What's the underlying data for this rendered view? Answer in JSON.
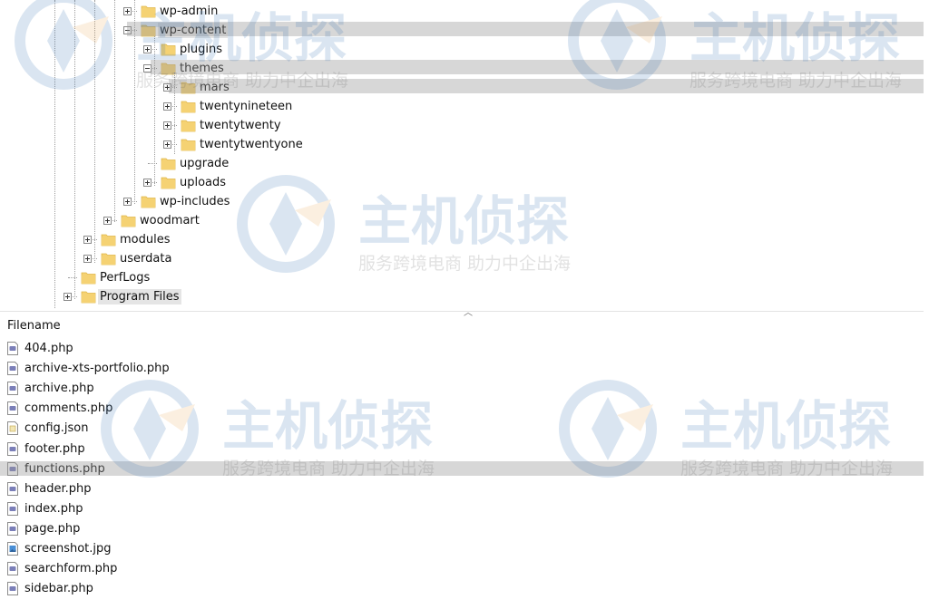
{
  "tree": {
    "items": [
      {
        "label": "wp-admin",
        "toggle": "plus"
      },
      {
        "label": "wp-content",
        "toggle": "minus",
        "selected": true
      },
      {
        "label": "plugins",
        "toggle": "plus"
      },
      {
        "label": "themes",
        "toggle": "minus"
      },
      {
        "label": "mars",
        "toggle": "plus"
      },
      {
        "label": "twentynineteen",
        "toggle": "plus"
      },
      {
        "label": "twentytwenty",
        "toggle": "plus"
      },
      {
        "label": "twentytwentyone",
        "toggle": "plus"
      },
      {
        "label": "upgrade",
        "toggle": "none"
      },
      {
        "label": "uploads",
        "toggle": "plus"
      },
      {
        "label": "wp-includes",
        "toggle": "plus"
      },
      {
        "label": "woodmart",
        "toggle": "plus"
      },
      {
        "label": "modules",
        "toggle": "plus"
      },
      {
        "label": "userdata",
        "toggle": "plus"
      },
      {
        "label": "PerfLogs",
        "toggle": "none"
      },
      {
        "label": "Program Files",
        "toggle": "plus",
        "selected": true
      }
    ]
  },
  "files": {
    "header": "Filename",
    "items": [
      {
        "name": "404.php",
        "icon": "php-file-icon"
      },
      {
        "name": "archive-xts-portfolio.php",
        "icon": "php-file-icon"
      },
      {
        "name": "archive.php",
        "icon": "php-file-icon"
      },
      {
        "name": "comments.php",
        "icon": "php-file-icon"
      },
      {
        "name": "config.json",
        "icon": "json-file-icon"
      },
      {
        "name": "footer.php",
        "icon": "php-file-icon"
      },
      {
        "name": "functions.php",
        "icon": "php-file-icon"
      },
      {
        "name": "header.php",
        "icon": "php-file-icon"
      },
      {
        "name": "index.php",
        "icon": "php-file-icon"
      },
      {
        "name": "page.php",
        "icon": "php-file-icon"
      },
      {
        "name": "screenshot.jpg",
        "icon": "image-file-icon"
      },
      {
        "name": "searchform.php",
        "icon": "php-file-icon"
      },
      {
        "name": "sidebar.php",
        "icon": "php-file-icon"
      }
    ]
  },
  "watermark": {
    "brand": "主机侦探",
    "slogan": "服务跨境电商 助力中企出海"
  },
  "colors": {
    "folder": "#f5d273",
    "folder_edge": "#e0b64a",
    "php_icon": "#7b7fb8",
    "watermark": "#2a6db0",
    "selection": "#e5e5e5"
  }
}
